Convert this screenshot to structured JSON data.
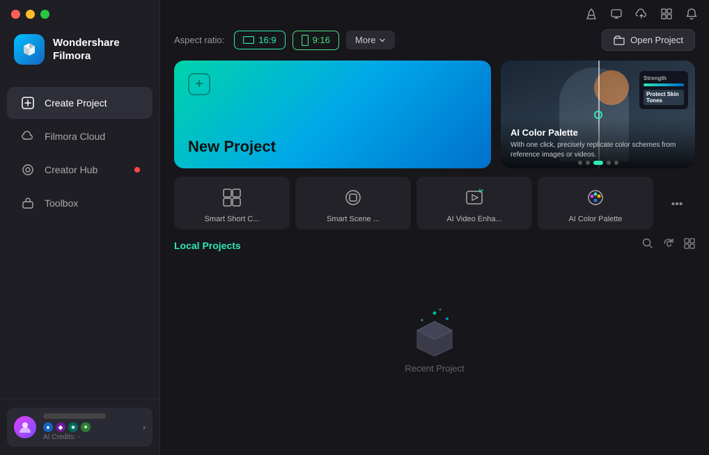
{
  "app": {
    "name": "Wondershare",
    "name2": "Filmora"
  },
  "sidebar": {
    "items": [
      {
        "id": "create-project",
        "label": "Create Project",
        "active": true,
        "dot": false
      },
      {
        "id": "filmora-cloud",
        "label": "Filmora Cloud",
        "active": false,
        "dot": false
      },
      {
        "id": "creator-hub",
        "label": "Creator Hub",
        "active": false,
        "dot": true
      },
      {
        "id": "toolbox",
        "label": "Toolbox",
        "active": false,
        "dot": false
      }
    ]
  },
  "aspect_ratio": {
    "label": "Aspect ratio:",
    "options": [
      {
        "id": "16-9",
        "label": "16:9",
        "active": true
      },
      {
        "id": "9-16",
        "label": "9:16",
        "active": false
      },
      {
        "id": "more",
        "label": "More",
        "active": false
      }
    ]
  },
  "open_project": {
    "label": "Open Project"
  },
  "new_project": {
    "label": "New Project"
  },
  "feature_card": {
    "title": "AI Color Palette",
    "description": "With one click, precisely replicate color schemes from reference images or videos.",
    "dots": [
      0,
      1,
      2,
      3,
      4
    ],
    "active_dot": 2
  },
  "tools": [
    {
      "id": "smart-short",
      "label": "Smart Short C...",
      "icon": "⊞"
    },
    {
      "id": "smart-scene",
      "label": "Smart Scene ...",
      "icon": "⊙"
    },
    {
      "id": "ai-video-enhance",
      "label": "AI Video Enha...",
      "icon": "⊡"
    },
    {
      "id": "ai-color-palette",
      "label": "AI Color Palette",
      "icon": "⊛"
    }
  ],
  "local_projects": {
    "title": "Local Projects",
    "empty_label": "Recent Project"
  },
  "user": {
    "credits_label": "AI Credits: -",
    "arrow": "›"
  },
  "topbar_icons": [
    "rocket",
    "monitor",
    "cloud",
    "grid",
    "bell"
  ]
}
